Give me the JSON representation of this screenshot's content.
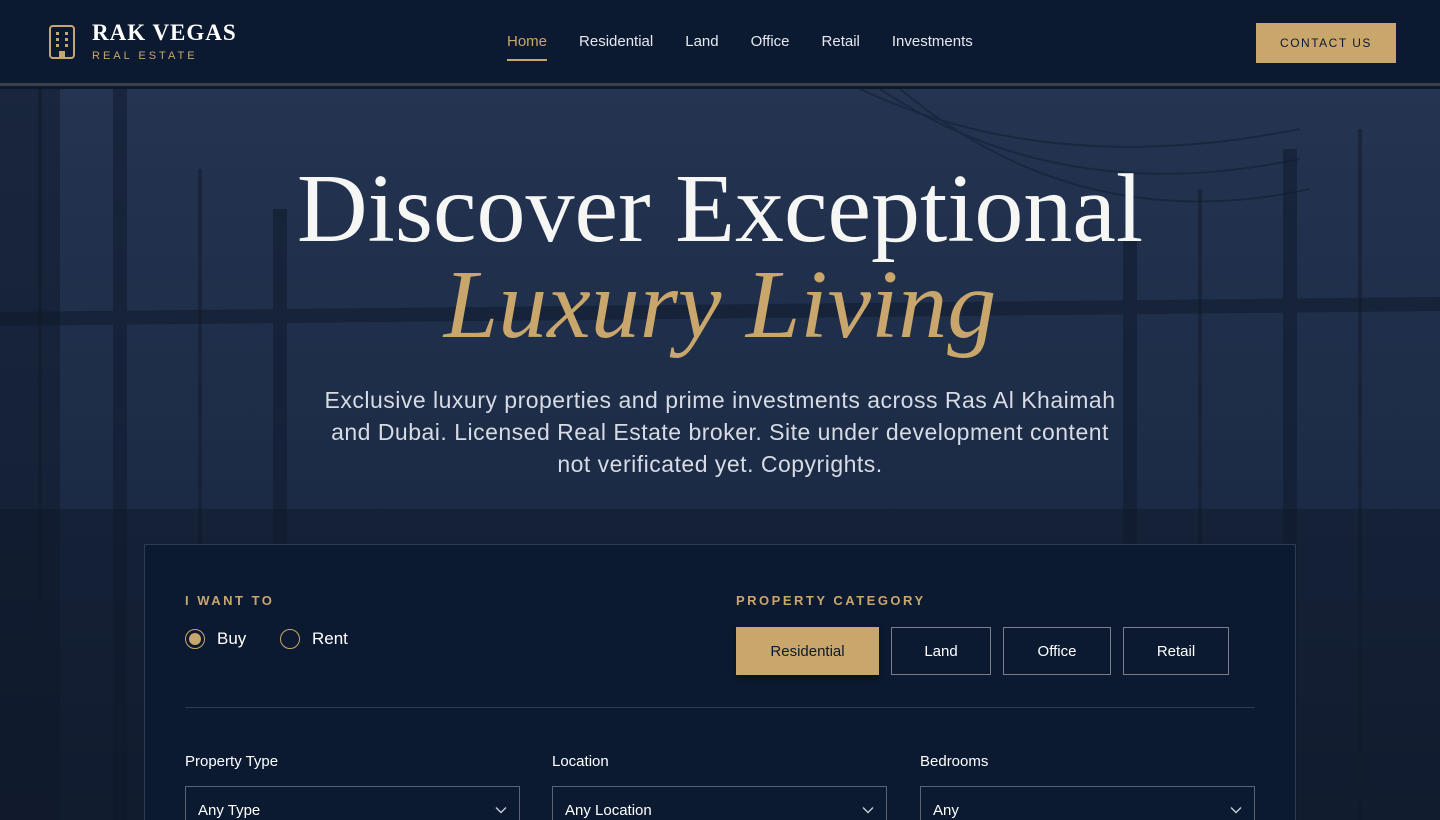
{
  "header": {
    "brand": "RAK VEGAS",
    "subtitle": "REAL ESTATE",
    "nav": [
      {
        "label": "Home",
        "active": true
      },
      {
        "label": "Residential",
        "active": false
      },
      {
        "label": "Land",
        "active": false
      },
      {
        "label": "Office",
        "active": false
      },
      {
        "label": "Retail",
        "active": false
      },
      {
        "label": "Investments",
        "active": false
      }
    ],
    "contact_label": "CONTACT US"
  },
  "hero": {
    "title_line1": "Discover Exceptional",
    "title_line2": "Luxury Living",
    "description": "Exclusive luxury properties and prime investments across Ras Al Khaimah and Dubai. Licensed Real Estate broker. Site under development content not verificated yet. Copyrights."
  },
  "search": {
    "intent_label": "I WANT TO",
    "intent_options": [
      {
        "label": "Buy",
        "selected": true
      },
      {
        "label": "Rent",
        "selected": false
      }
    ],
    "category_label": "PROPERTY CATEGORY",
    "categories": [
      {
        "label": "Residential",
        "active": true
      },
      {
        "label": "Land",
        "active": false
      },
      {
        "label": "Office",
        "active": false
      },
      {
        "label": "Retail",
        "active": false
      }
    ],
    "fields": [
      {
        "label": "Property Type",
        "value": "Any Type"
      },
      {
        "label": "Location",
        "value": "Any Location"
      },
      {
        "label": "Bedrooms",
        "value": "Any"
      }
    ]
  },
  "colors": {
    "navy": "#0c1a31",
    "gold": "#c9a66b"
  }
}
